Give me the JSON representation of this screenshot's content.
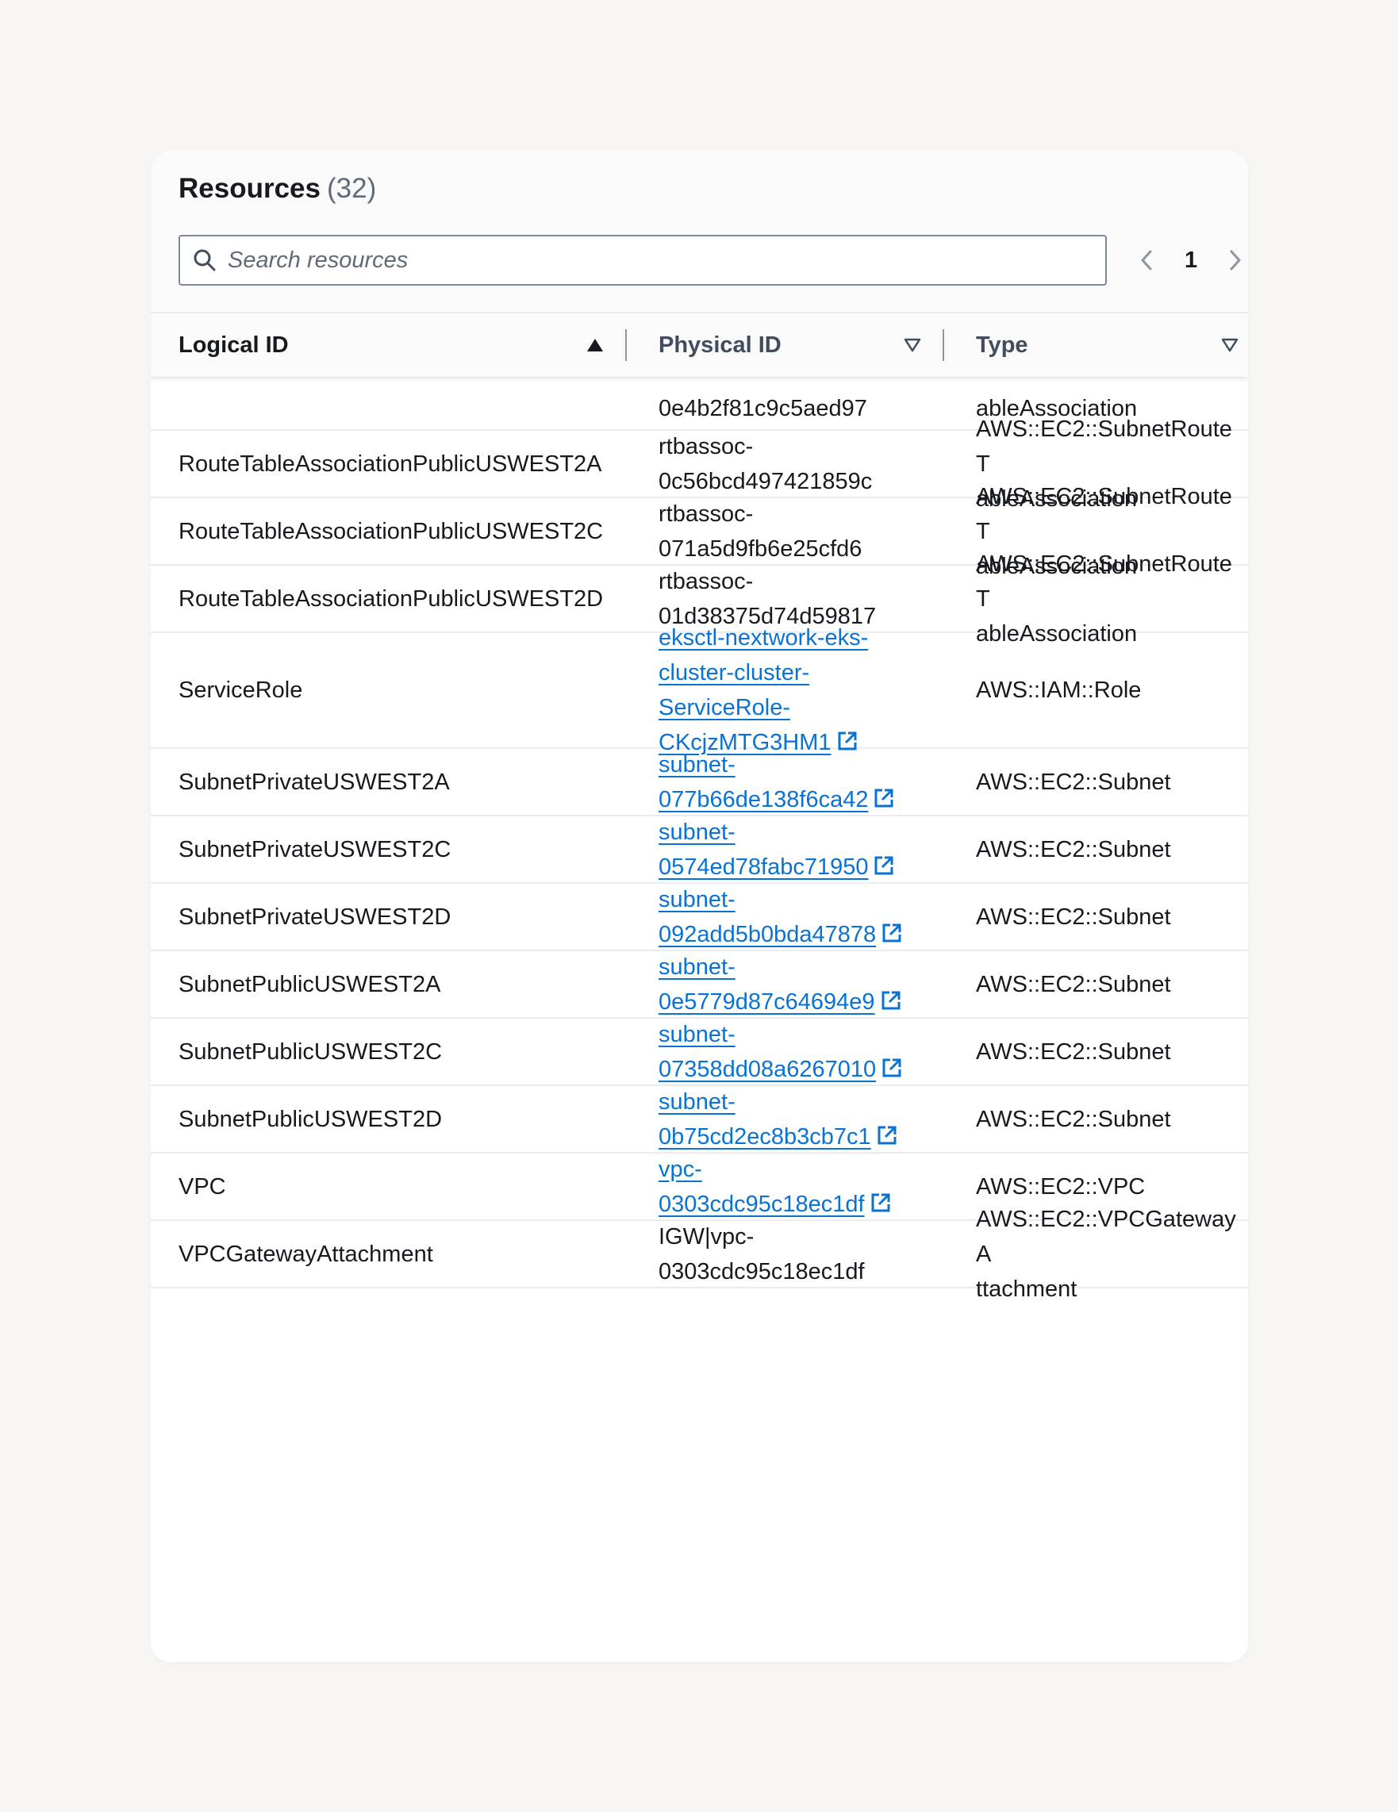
{
  "header": {
    "title": "Resources",
    "count": "(32)"
  },
  "search": {
    "placeholder": "Search resources"
  },
  "pagination": {
    "current_page": "1"
  },
  "table": {
    "columns": {
      "logical_id": "Logical ID",
      "physical_id": "Physical ID",
      "type": "Type"
    },
    "partial_row": {
      "physical_id": "0e4b2f81c9c5aed97",
      "type": "ableAssociation"
    },
    "rows": [
      {
        "logical_id": "RouteTableAssociationPublicUSWEST2A",
        "physical_lines": [
          "rtbassoc-",
          "0c56bcd497421859c"
        ],
        "type_lines": [
          "AWS::EC2::SubnetRouteT",
          "ableAssociation"
        ]
      },
      {
        "logical_id": "RouteTableAssociationPublicUSWEST2C",
        "physical_lines": [
          "rtbassoc-",
          "071a5d9fb6e25cfd6"
        ],
        "type_lines": [
          "AWS::EC2::SubnetRouteT",
          "ableAssociation"
        ]
      },
      {
        "logical_id": "RouteTableAssociationPublicUSWEST2D",
        "physical_lines": [
          "rtbassoc-",
          "01d38375d74d59817"
        ],
        "type_lines": [
          "AWS::EC2::SubnetRouteT",
          "ableAssociation"
        ]
      },
      {
        "logical_id": "ServiceRole",
        "physical_lines": [
          "eksctl-nextwork-eks-",
          "cluster-cluster-",
          "ServiceRole-",
          "CKcjzMTG3HM1"
        ],
        "type_lines": [
          "AWS::IAM::Role"
        ]
      },
      {
        "logical_id": "SubnetPrivateUSWEST2A",
        "physical_lines": [
          "subnet-",
          "077b66de138f6ca42"
        ],
        "type_lines": [
          "AWS::EC2::Subnet"
        ]
      },
      {
        "logical_id": "SubnetPrivateUSWEST2C",
        "physical_lines": [
          "subnet-",
          "0574ed78fabc71950"
        ],
        "type_lines": [
          "AWS::EC2::Subnet"
        ]
      },
      {
        "logical_id": "SubnetPrivateUSWEST2D",
        "physical_lines": [
          "subnet-",
          "092add5b0bda47878"
        ],
        "type_lines": [
          "AWS::EC2::Subnet"
        ]
      },
      {
        "logical_id": "SubnetPublicUSWEST2A",
        "physical_lines": [
          "subnet-",
          "0e5779d87c64694e9"
        ],
        "type_lines": [
          "AWS::EC2::Subnet"
        ]
      },
      {
        "logical_id": "SubnetPublicUSWEST2C",
        "physical_lines": [
          "subnet-",
          "07358dd08a6267010"
        ],
        "type_lines": [
          "AWS::EC2::Subnet"
        ]
      },
      {
        "logical_id": "SubnetPublicUSWEST2D",
        "physical_lines": [
          "subnet-",
          "0b75cd2ec8b3cb7c1"
        ],
        "type_lines": [
          "AWS::EC2::Subnet"
        ]
      },
      {
        "logical_id": "VPC",
        "physical_lines": [
          "vpc-",
          "0303cdc95c18ec1df"
        ],
        "type_lines": [
          "AWS::EC2::VPC"
        ]
      },
      {
        "logical_id": "VPCGatewayAttachment",
        "physical_lines": [
          "IGW|vpc-",
          "0303cdc95c18ec1df"
        ],
        "type_lines": [
          "AWS::EC2::VPCGatewayA",
          "ttachment"
        ]
      }
    ]
  },
  "colors": {
    "link": "#0972d3",
    "text": "#16191f",
    "muted": "#5f6b7a",
    "border": "#e9ebed",
    "background": "#f7f5f1"
  },
  "icons": {
    "search": "search-icon",
    "prev": "chevron-left-icon",
    "next": "chevron-right-icon",
    "sort_asc": "sort-ascending-icon",
    "sort_none": "sort-descending-outline-icon",
    "external": "external-link-icon"
  }
}
